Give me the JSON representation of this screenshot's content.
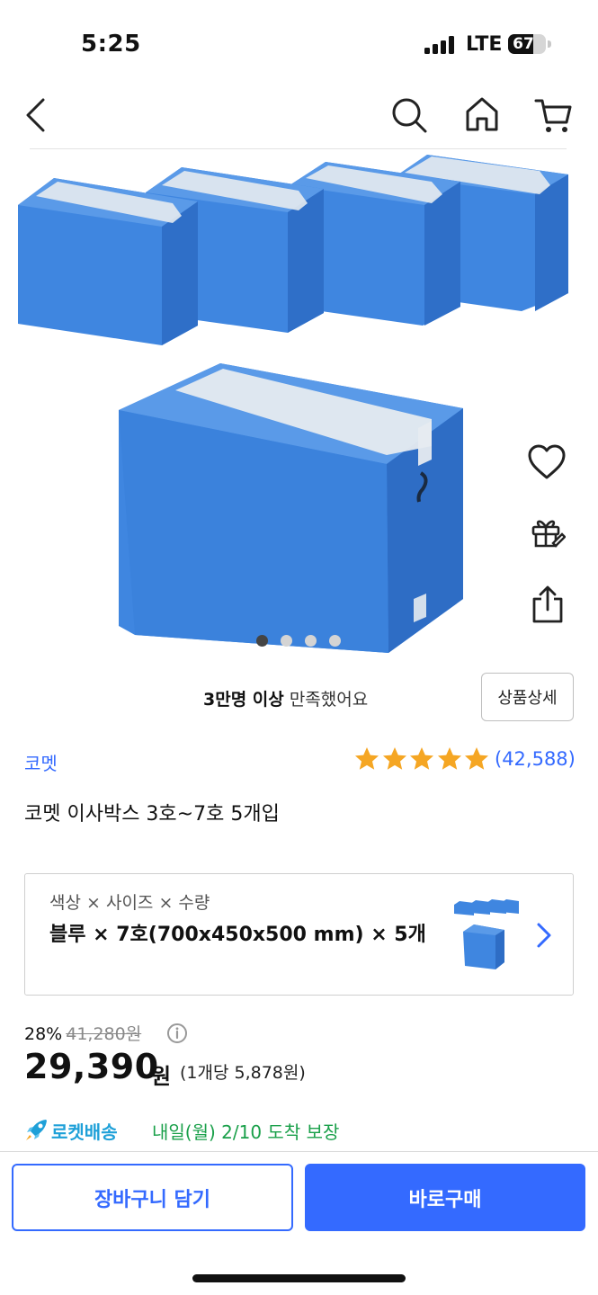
{
  "status_bar": {
    "time": "5:25",
    "network": "LTE",
    "battery_percent": 67,
    "battery_label": "67"
  },
  "nav": {
    "icons": [
      "back-icon",
      "search-icon",
      "home-icon",
      "cart-icon"
    ]
  },
  "gallery": {
    "image_count": 4,
    "active_index": 0,
    "side_icons": [
      "heart-icon",
      "gift-icon",
      "share-icon"
    ],
    "product_color": "#3f86e0"
  },
  "satisfaction": {
    "highlight": "3만명 이상",
    "text": "만족했어요",
    "detail_button": "상품상세"
  },
  "product": {
    "brand": "코멧",
    "name": "코멧 이사박스 3호~7호 5개입",
    "rating_stars": 5,
    "review_count": "(42,588)"
  },
  "option": {
    "label": "색상 × 사이즈 × 수량",
    "value": "블루 × 7호(700x450x500 mm) × 5개"
  },
  "price": {
    "discount": "28%",
    "original": "41,280원",
    "amount": "29,390",
    "unit": "원",
    "per_unit": "(1개당 5,878원)"
  },
  "delivery": {
    "type": "로켓배송",
    "arrival": "내일(월) 2/10 도착 보장"
  },
  "actions": {
    "cart": "장바구니 담기",
    "buy": "바로구매"
  },
  "colors": {
    "accent": "#346aff",
    "rocket": "#1ea0d8",
    "arrival": "#1aa04a",
    "star": "#f5a623"
  }
}
